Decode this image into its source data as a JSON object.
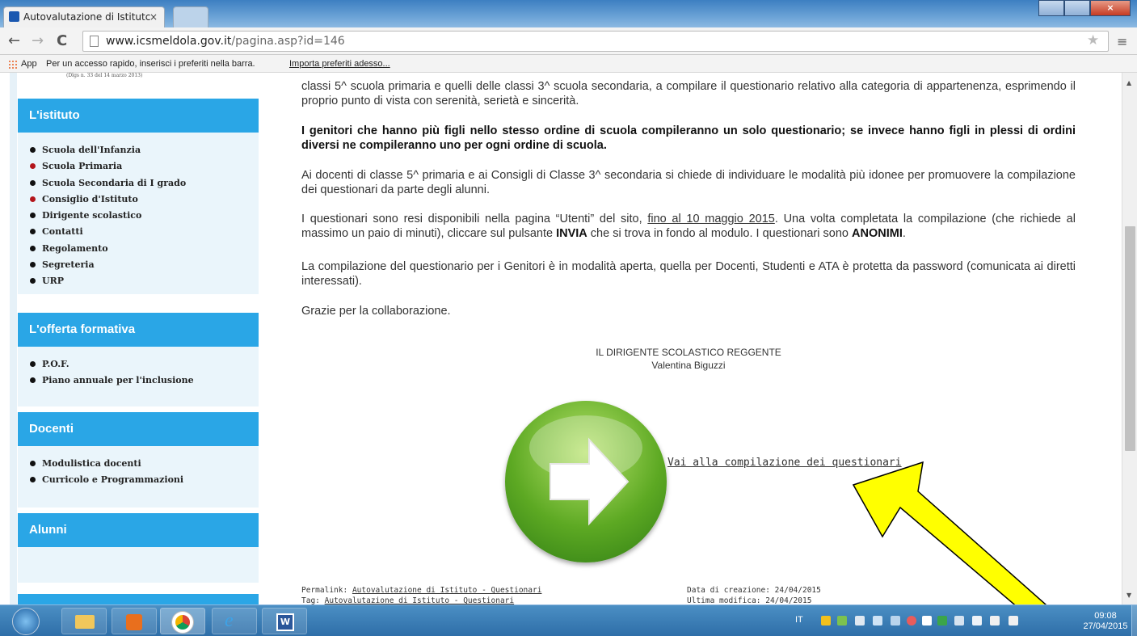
{
  "browser": {
    "tab_title": "Autovalutazione di Istitutc",
    "tab_close": "×",
    "url_host": "www.icsmeldola.gov.it",
    "url_path": "/pagina.asp?id=146",
    "back": "←",
    "forward": "→",
    "reload": "C",
    "star": "★",
    "menu": "≡"
  },
  "bookmarks": {
    "apps_label": "App",
    "hint": "Per un accesso rapido, inserisci i preferiti nella barra.",
    "import_link": "Importa preferiti adesso..."
  },
  "sidebar": {
    "logo_caption": "(Dlgs n. 33 del 14 marzo 2013)",
    "sections": [
      {
        "title": "L'istituto",
        "items": [
          "Scuola dell'Infanzia",
          "Scuola Primaria",
          "Scuola Secondaria di I grado",
          "Consiglio d'Istituto",
          "Dirigente scolastico",
          "Contatti",
          "Regolamento",
          "Segreteria",
          "URP"
        ]
      },
      {
        "title": "L'offerta formativa",
        "items": [
          "P.O.F.",
          "Piano annuale per l'inclusione"
        ]
      },
      {
        "title": "Docenti",
        "items": [
          "Modulistica docenti",
          "Curricolo e Programmazioni"
        ]
      },
      {
        "title": "Alunni",
        "items": []
      }
    ]
  },
  "content": {
    "p1": "classi 5^ scuola primaria e quelli delle classi 3^ scuola secondaria, a compilare il questionario relativo alla categoria di appartenenza, esprimendo il proprio punto di vista con serenità, serietà e sincerità.",
    "p2": "I genitori che hanno più figli nello stesso ordine di scuola compileranno un solo questionario; se invece hanno figli in plessi di ordini diversi ne compileranno uno per ogni ordine di scuola.",
    "p3": "Ai docenti di classe 5^ primaria e ai Consigli di Classe 3^ secondaria si chiede di individuare le modalità più idonee per promuovere la compilazione dei questionari da parte degli alunni.",
    "p4_a": "I questionari sono resi disponibili nella pagina “Utenti” del sito, ",
    "p4_date": "fino al 10 maggio 2015",
    "p4_b": ". Una volta completata la compilazione (che richiede al massimo un paio di minuti), cliccare sul pulsante ",
    "p4_invia": "INVIA",
    "p4_c": " che si trova in fondo al modulo. I questionari sono ",
    "p4_anonimi": "ANONIMI",
    "p4_d": ".",
    "p5": "La compilazione del questionario per i Genitori è in modalità aperta, quella per Docenti, Studenti e ATA è protetta da password (comunicata ai diretti interessati).",
    "p6": "Grazie per la collaborazione.",
    "sign_role": "IL DIRIGENTE SCOLASTICO REGGENTE",
    "sign_name": "Valentina Biguzzi",
    "cta_link": "Vai alla compilazione dei questionari",
    "permalink_label": "Permalink:",
    "permalink_value": "Autovalutazione di Istituto - Questionari",
    "tag_label": "Tag:",
    "tag_value": "Autovalutazione di Istituto - Questionari",
    "created": "Data di creazione: 24/04/2015",
    "modified": "Ultima modifica: 24/04/2015"
  },
  "taskbar": {
    "lang": "IT",
    "time": "09:08",
    "date": "27/04/2015"
  },
  "colors": {
    "accent": "#2aa6e6",
    "arrow": "#ffff00"
  }
}
